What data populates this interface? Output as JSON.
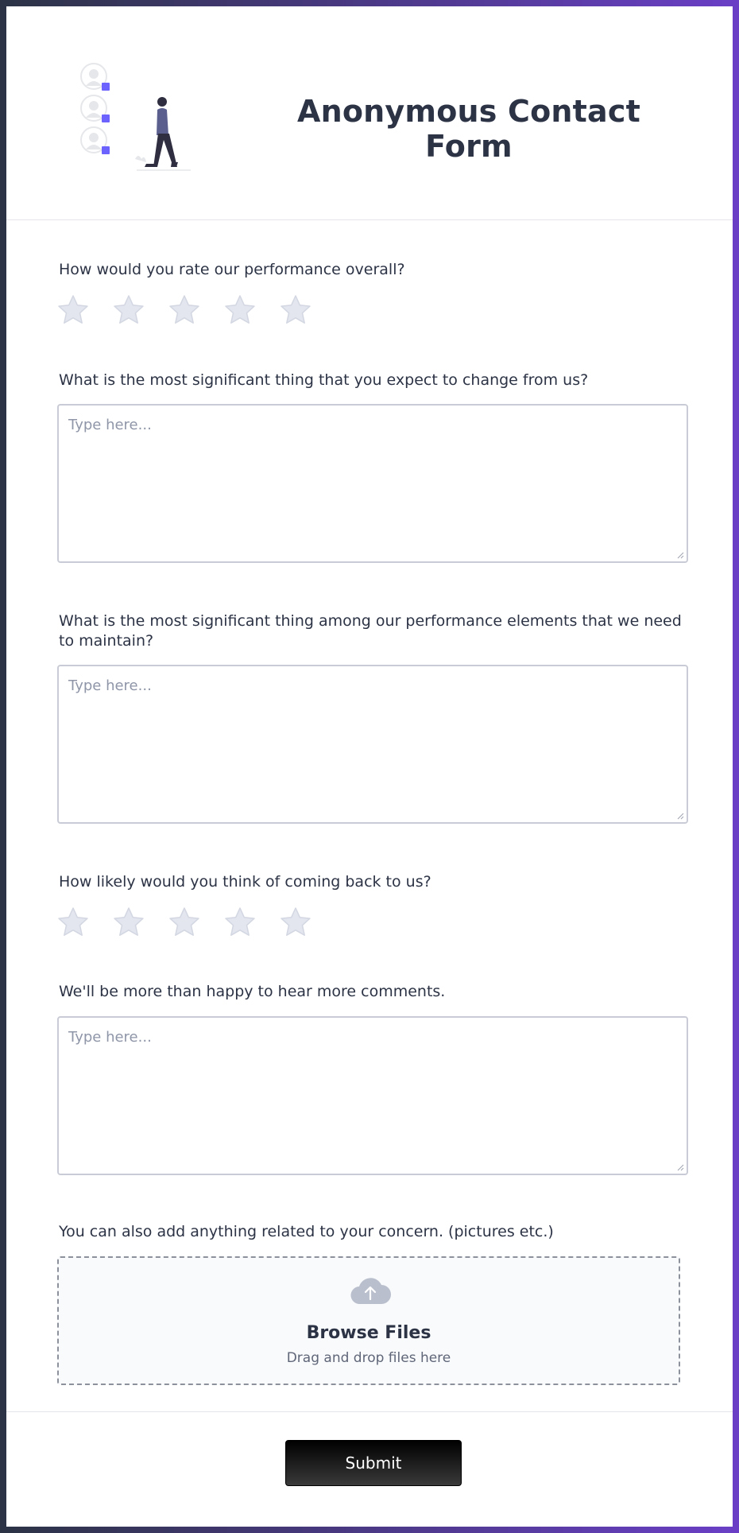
{
  "form": {
    "title": "Anonymous Contact Form"
  },
  "questions": [
    {
      "label": "How would you rate our performance overall?",
      "type": "rating",
      "max_stars": 5,
      "selected": 0
    },
    {
      "label": "What is the most significant thing that you expect to change from us?",
      "type": "textarea",
      "placeholder": "Type here..."
    },
    {
      "label": "What is the most significant thing among our performance elements that we need to maintain?",
      "type": "textarea",
      "placeholder": "Type here..."
    },
    {
      "label": "How likely would you think of coming back to us?",
      "type": "rating",
      "max_stars": 5,
      "selected": 0
    },
    {
      "label": "We'll be more than happy to hear more comments.",
      "type": "textarea",
      "placeholder": "Type here..."
    },
    {
      "label": "You can also add anything related to your concern. (pictures etc.)",
      "type": "upload"
    }
  ],
  "upload": {
    "button_label": "Browse Files",
    "hint": "Drag and drop files here",
    "icon": "cloud-upload-icon"
  },
  "submit_label": "Submit",
  "colors": {
    "text": "#2c3345",
    "star_empty": "#e3e6ee",
    "accent": "#6a3fc6",
    "submit_bg": "#000000"
  }
}
